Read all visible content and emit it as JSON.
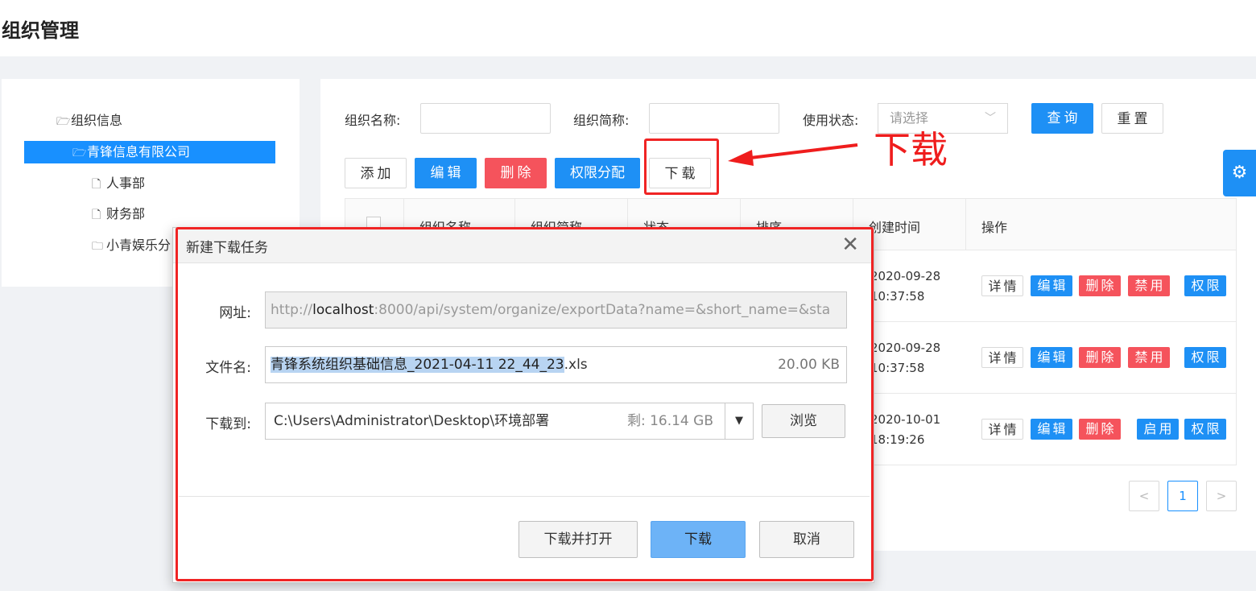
{
  "page": {
    "title": "组织管理"
  },
  "tree": {
    "items": [
      {
        "label": "组织信息",
        "icon": "folder-open-icon"
      },
      {
        "label": "青锋信息有限公司",
        "icon": "folder-open-icon",
        "selected": true
      },
      {
        "label": "人事部",
        "icon": "file-icon"
      },
      {
        "label": "财务部",
        "icon": "file-icon"
      },
      {
        "label": "小青娱乐分",
        "icon": "folder-icon"
      }
    ]
  },
  "filters": {
    "org_name_label": "组织名称:",
    "org_short_label": "组织简称:",
    "status_label": "使用状态:",
    "status_placeholder": "请选择",
    "query": "查询",
    "reset": "重置"
  },
  "toolbar": {
    "add": "添加",
    "edit": "编辑",
    "delete": "删除",
    "assign": "权限分配",
    "download": "下载"
  },
  "annotation": {
    "text": "下载"
  },
  "table": {
    "headers": [
      "组织名称",
      "组织简称",
      "状态",
      "排序",
      "创建时间",
      "操作"
    ],
    "rows": [
      {
        "date": "2020-09-28",
        "time": "10:37:58",
        "ops": [
          "详情",
          "编辑",
          "删除",
          "禁用",
          "权限"
        ]
      },
      {
        "date": "2020-09-28",
        "time": "10:37:58",
        "ops": [
          "详情",
          "编辑",
          "删除",
          "禁用",
          "权限"
        ]
      },
      {
        "date": "2020-10-01",
        "time": "18:19:26",
        "ops": [
          "详情",
          "编辑",
          "删除",
          "启用",
          "权限"
        ]
      }
    ]
  },
  "pagination": {
    "prev": "<",
    "current": "1",
    "next": ">"
  },
  "dialog": {
    "title": "新建下载任务",
    "url_label": "网址:",
    "url_prefix": "http://",
    "url_host": "localhost",
    "url_rest": ":8000/api/system/organize/exportData?name=&short_name=&sta",
    "filename_label": "文件名:",
    "filename": "青锋系统组织基础信息_2021-04-11 22_44_23",
    "filename_ext": ".xls",
    "filesize": "20.00 KB",
    "path_label": "下载到:",
    "path": "C:\\Users\\Administrator\\Desktop\\环境部署",
    "free_space": "剩: 16.14 GB",
    "browse": "浏览",
    "download_open": "下载并打开",
    "download": "下载",
    "cancel": "取消"
  },
  "colors": {
    "primary": "#1e90f5",
    "danger": "#f5535c",
    "annotation": "#ef1d1d"
  }
}
